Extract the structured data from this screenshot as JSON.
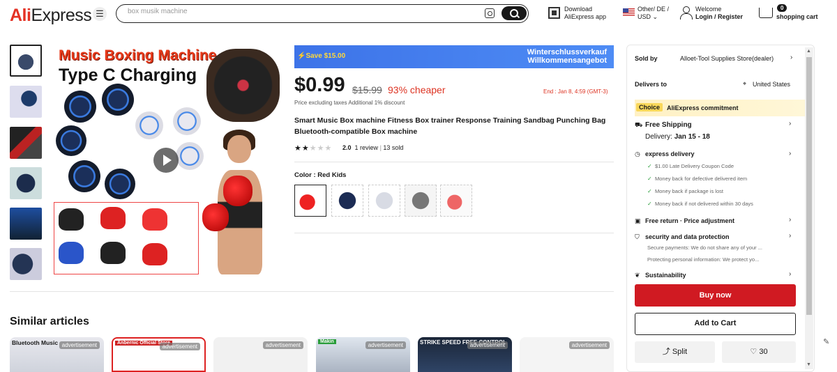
{
  "header": {
    "logo_part1": "Ali",
    "logo_part2": "Express",
    "search_value": "box musik machine",
    "app_line1": "Download",
    "app_line2": "AliExpress app",
    "locale_line1": "Other/ DE /",
    "locale_line2": "USD",
    "welcome_line1": "Welcome",
    "welcome_line2": "Login / Register",
    "cart_count": "0",
    "cart_label": "shopping cart"
  },
  "gallery": {
    "title_line1": "Music Boxing Machine",
    "title_line2": "Type C Charging"
  },
  "banner": {
    "save": "⚡Save $15.00",
    "promo_line1": "Winterschlussverkauf",
    "promo_line2": "Willkommensangebot"
  },
  "product": {
    "price": "$0.99",
    "old_price": "$15.99",
    "discount": "93% cheaper",
    "end_text": "End : Jan 8, 4:59 (GMT-3)",
    "tax_note": "Price excluding taxes Additional 1% discount",
    "title": "Smart Music Box machine Fitness Box trainer Response Training Sandbag Punching Bag Bluetooth-compatible Box machine",
    "rating": "2.0",
    "stars_filled": 2,
    "stars_total": 5,
    "reviews": "1 review",
    "sold": "13 sold",
    "color_label": "Color : Red Kids"
  },
  "panel": {
    "sold_by_label": "Sold by",
    "seller": "Alloet-Tool Supplies Store(dealer)",
    "delivers_to_label": "Delivers to",
    "country": "United States",
    "choice_tag": "Choice",
    "choice_text": "AliExpress commitment",
    "free_shipping": "Free Shipping",
    "delivery_label": "Delivery:",
    "delivery_dates": "Jan 15 - 18",
    "express": "express delivery",
    "benefits": [
      "$1.00 Late Delivery Coupon Code",
      "Money back for defective delivered item",
      "Money back if package is lost",
      "Money back if not delivered within 30 days"
    ],
    "free_return": "Free return · Price adjustment",
    "security": "security and data protection",
    "secure_payments": "Secure payments: We do not share any of your ...",
    "protecting_info": "Protecting personal information: We protect yo...",
    "sustainability": "Sustainability",
    "buy_now": "Buy now",
    "add_to_cart": "Add to Cart",
    "split": "Split",
    "wish_count": "30"
  },
  "similar": {
    "heading": "Similar articles",
    "cards": [
      {
        "label": "Bluetooth Music",
        "ad": "advertisement"
      },
      {
        "label": "Anbernic Official Store",
        "ad": "advertisement"
      },
      {
        "label": "",
        "ad": "advertisement"
      },
      {
        "label": "Makin",
        "ad": "advertisement"
      },
      {
        "label": "STRIKE SPEED FREE CONTROL",
        "ad": "advertisement"
      },
      {
        "label": "",
        "ad": "advertisement"
      }
    ]
  },
  "colors": {
    "accent_red": "#d01a22",
    "discount_red": "#dd3322",
    "banner_blue": "#3d73e8"
  }
}
